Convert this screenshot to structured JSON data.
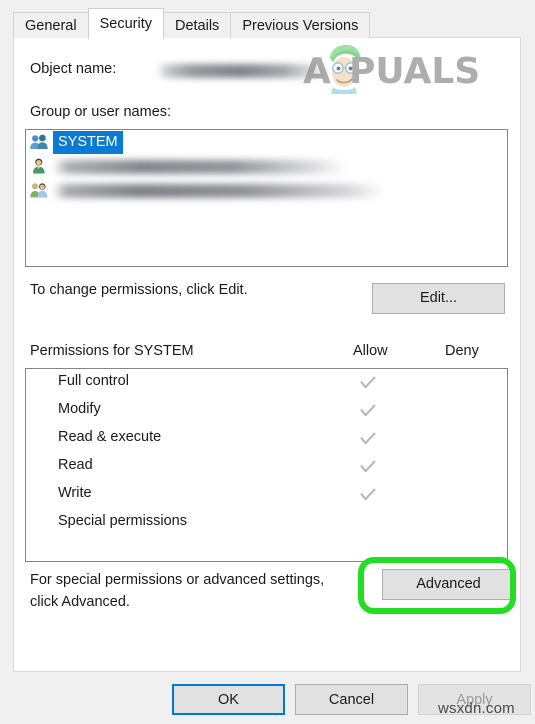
{
  "dialog": {
    "tabs": [
      {
        "label": "General",
        "active": false
      },
      {
        "label": "Security",
        "active": true
      },
      {
        "label": "Details",
        "active": false
      },
      {
        "label": "Previous Versions",
        "active": false
      }
    ],
    "object_name_label": "Object name:",
    "object_name_value": "",
    "group_label": "Group or user names:",
    "users": [
      {
        "name": "SYSTEM",
        "selected": true,
        "redacted": false,
        "icon": "group-users-icon"
      },
      {
        "name": "",
        "selected": false,
        "redacted": true,
        "icon": "single-user-icon"
      },
      {
        "name": "",
        "selected": false,
        "redacted": true,
        "icon": "group-users-icon"
      }
    ],
    "edit_hint": "To change permissions, click Edit.",
    "edit_button": "Edit...",
    "permissions_title": "Permissions for SYSTEM",
    "allow_header": "Allow",
    "deny_header": "Deny",
    "permissions": [
      {
        "name": "Full control",
        "allow": true,
        "deny": false
      },
      {
        "name": "Modify",
        "allow": true,
        "deny": false
      },
      {
        "name": "Read & execute",
        "allow": true,
        "deny": false
      },
      {
        "name": "Read",
        "allow": true,
        "deny": false
      },
      {
        "name": "Write",
        "allow": true,
        "deny": false
      },
      {
        "name": "Special permissions",
        "allow": false,
        "deny": false
      }
    ],
    "advanced_hint_line1": "For special permissions or advanced settings,",
    "advanced_hint_line2": "click Advanced.",
    "advanced_button": "Advanced",
    "footer": {
      "ok": "OK",
      "cancel": "Cancel",
      "apply": "Apply"
    }
  },
  "watermarks": {
    "appuals_a": "A",
    "appuals_rest": "PUALS",
    "site": "wsxdn.com"
  },
  "colors": {
    "selection_blue": "#0b7ad4",
    "focus_blue": "#0078d7",
    "highlight_green": "#22dd22",
    "checkmark_gray": "#b6b6b6",
    "dialog_gray": "#f0f0f0",
    "button_face": "#e1e1e1"
  }
}
